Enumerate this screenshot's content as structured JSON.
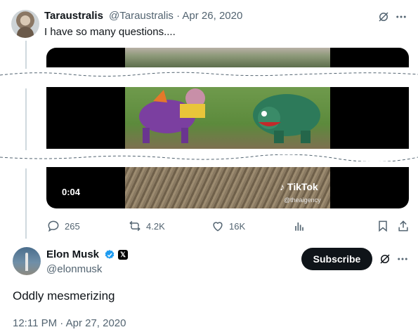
{
  "parent_tweet": {
    "display_name": "Taraustralis",
    "handle_and_date": "@Taraustralis · Apr 26, 2020",
    "text": "I have so many questions....",
    "video": {
      "timecode": "0:04",
      "watermark": "TikTok",
      "watermark_handle": "@theaigency"
    },
    "actions": {
      "replies": "265",
      "retweets": "4.2K",
      "likes": "16K"
    }
  },
  "main_tweet": {
    "display_name": "Elon Musk",
    "handle": "@elonmusk",
    "badge_x": "𝕏",
    "subscribe_label": "Subscribe",
    "text": "Oddly mesmerizing",
    "timestamp": "12:11 PM · Apr 27, 2020"
  },
  "colors": {
    "text_primary": "#0f1419",
    "text_secondary": "#536471",
    "verified_blue": "#1d9bf0",
    "thread_line": "#cfd9de"
  },
  "icons": [
    "grok-icon",
    "more-icon",
    "reply-icon",
    "retweet-icon",
    "like-icon",
    "views-icon",
    "bookmark-icon",
    "share-icon",
    "verified-icon"
  ]
}
